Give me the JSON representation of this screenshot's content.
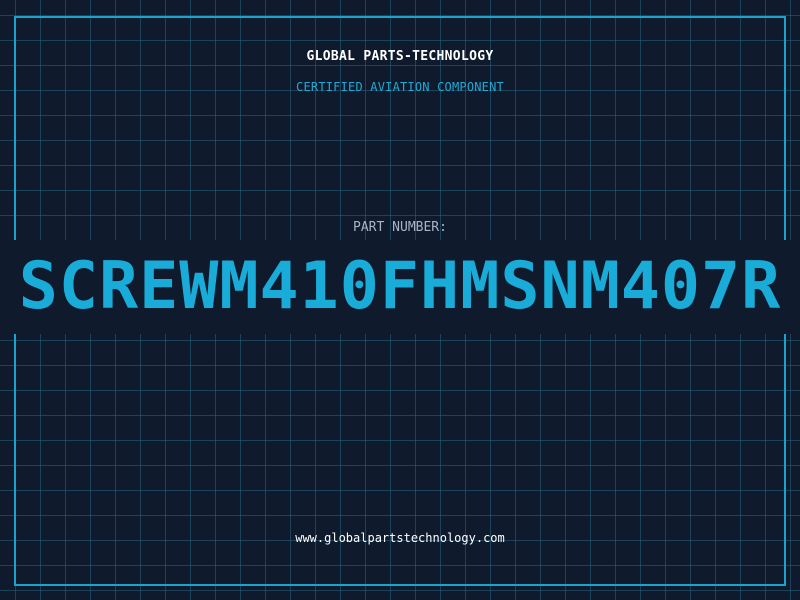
{
  "label": {
    "company": "GLOBAL PARTS-TECHNOLOGY",
    "certification": "CERTIFIED AVIATION COMPONENT",
    "part_number_label": "PART NUMBER:",
    "part_number": "SCREWM410FHMSNM407R",
    "website": "www.globalpartstechnology.com"
  },
  "colors": {
    "background": "#101a2d",
    "grid": "#266480",
    "accent": "#19acd8",
    "text": "#ffffff",
    "muted": "#a9b5c6"
  }
}
